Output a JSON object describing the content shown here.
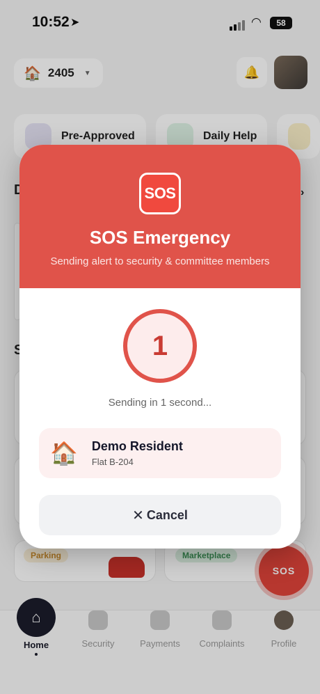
{
  "status_bar": {
    "time": "10:52",
    "battery": "58"
  },
  "header": {
    "unit": "2405"
  },
  "quick_actions": [
    {
      "label": "Pre-Approved"
    },
    {
      "label": "Daily Help"
    }
  ],
  "background": {
    "section_letter_1": "D",
    "section_letter_2": "S",
    "arrow": "›",
    "tags": {
      "parking": "Parking",
      "marketplace": "Marketplace"
    }
  },
  "sos_fab": {
    "label": "SOS"
  },
  "tabbar": {
    "items": [
      {
        "label": "Home"
      },
      {
        "label": "Security"
      },
      {
        "label": "Payments"
      },
      {
        "label": "Complaints"
      },
      {
        "label": "Profile"
      }
    ]
  },
  "modal": {
    "badge": "SOS",
    "title": "SOS Emergency",
    "subtitle": "Sending alert to security & committee members",
    "countdown": "1",
    "sending_text": "Sending in 1 second...",
    "resident": {
      "emoji": "🏠",
      "name": "Demo Resident",
      "flat": "Flat B-204"
    },
    "cancel_label": "Cancel"
  },
  "colors": {
    "accent": "#e0534a",
    "dark": "#1b1d2b"
  }
}
